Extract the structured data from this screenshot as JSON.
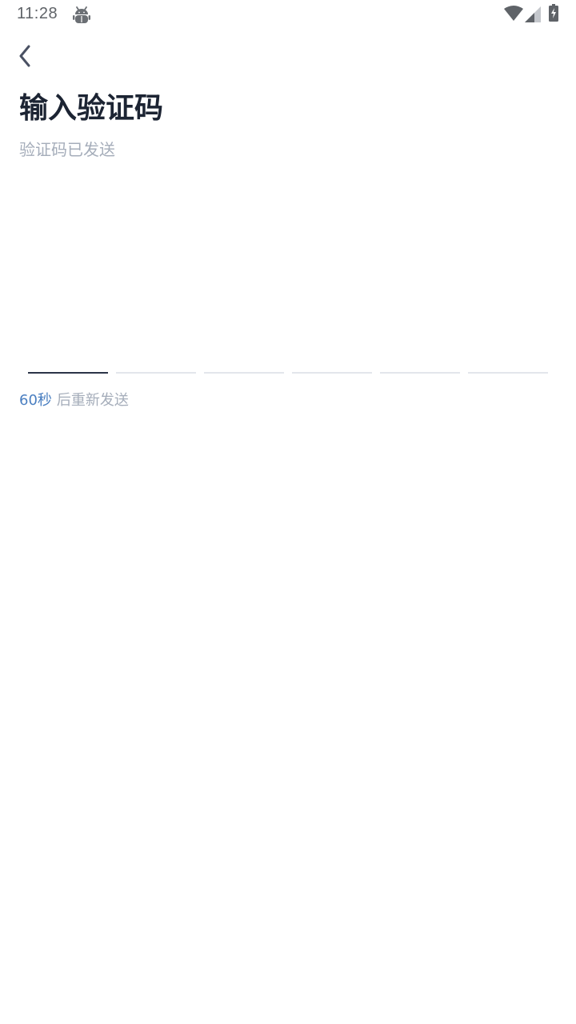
{
  "status_bar": {
    "time": "11:28",
    "icons": [
      "android-debug-icon",
      "wifi-icon",
      "cellular-signal-icon",
      "battery-charging-icon"
    ]
  },
  "nav": {
    "back_icon": "chevron-left-icon"
  },
  "header": {
    "title": "输入验证码",
    "subtitle": "验证码已发送"
  },
  "code_input": {
    "length": 6,
    "active_index": 0,
    "digits": [
      "",
      "",
      "",
      "",
      "",
      ""
    ]
  },
  "resend": {
    "countdown": "60秒",
    "label": "后重新发送"
  },
  "colors": {
    "title": "#1c2433",
    "muted_text": "#a5adba",
    "accent": "#4a7fc1",
    "active_underline": "#2b3448",
    "inactive_underline": "#e3e6eb",
    "status_icons": "#5f6368"
  }
}
